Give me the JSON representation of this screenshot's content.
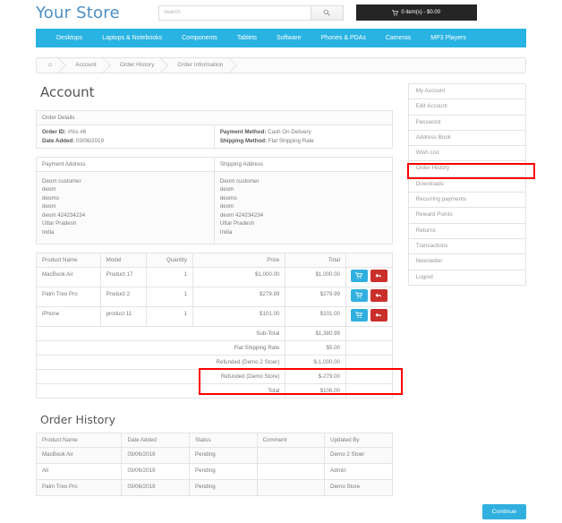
{
  "header": {
    "logo": "Your Store",
    "search_placeholder": "Search",
    "search_value": "",
    "search_icon": "search-icon",
    "cart_icon": "cart-icon",
    "cart_label": "0 item(s) - $0.00"
  },
  "nav": {
    "items": [
      {
        "label": "Desktops"
      },
      {
        "label": "Laptops & Notebooks"
      },
      {
        "label": "Components"
      },
      {
        "label": "Tablets"
      },
      {
        "label": "Software"
      },
      {
        "label": "Phones & PDAs"
      },
      {
        "label": "Cameras"
      },
      {
        "label": "MP3 Players"
      }
    ]
  },
  "breadcrumb": {
    "home_icon": "home-icon",
    "home_glyph": "⌂",
    "items": [
      {
        "label": "Account"
      },
      {
        "label": "Order History"
      },
      {
        "label": "Order Information"
      }
    ]
  },
  "page": {
    "title": "Account",
    "history_title": "Order History"
  },
  "order_details": {
    "panel_title": "Order Details",
    "order_id_label": "Order ID:",
    "order_id_value": "#%s #6",
    "date_added_label": "Date Added:",
    "date_added_value": "03/06/2019",
    "payment_method_label": "Payment Method:",
    "payment_method_value": "Cash On Delivery",
    "shipping_method_label": "Shipping Method:",
    "shipping_method_value": "Flat Shipping Rate"
  },
  "addresses": {
    "payment_title": "Payment Address",
    "shipping_title": "Shipping Address",
    "payment_lines": [
      "Deom customer",
      "deom",
      "deomo",
      "deom",
      "deom 424234234",
      "Uttar Pradesh",
      "India"
    ],
    "shipping_lines": [
      "Deom customer",
      "deom",
      "deomo",
      "deom",
      "deom 424234234",
      "Uttar Pradesh",
      "India"
    ]
  },
  "products": {
    "columns": [
      "Product Name",
      "Model",
      "Quantity",
      "Price",
      "Total",
      ""
    ],
    "rows": [
      {
        "name": "MacBook Air",
        "model": "Product 17",
        "quantity": "1",
        "price": "$1,000.00",
        "total": "$1,000.00",
        "cart_icon": "cart-icon",
        "return_icon": "return-arrow-icon"
      },
      {
        "name": "Palm Treo Pro",
        "model": "Product 2",
        "quantity": "1",
        "price": "$279.99",
        "total": "$279.99",
        "cart_icon": "cart-icon",
        "return_icon": "return-arrow-icon"
      },
      {
        "name": "iPhone",
        "model": "product 11",
        "quantity": "1",
        "price": "$101.00",
        "total": "$101.00",
        "cart_icon": "cart-icon",
        "return_icon": "return-arrow-icon"
      }
    ],
    "totals": [
      {
        "label": "Sub-Total",
        "value": "$1,380.99",
        "highlight": false
      },
      {
        "label": "Flat Shipping Rate",
        "value": "$5.00",
        "highlight": false
      },
      {
        "label": "Refunded (Demo 2 Stoer)",
        "value": "$-1,000.00",
        "highlight": true
      },
      {
        "label": "Refunded (Demo Store)",
        "value": "$-279.00",
        "highlight": true
      },
      {
        "label": "Total",
        "value": "$106.00",
        "highlight": false
      }
    ]
  },
  "order_history": {
    "columns": [
      "Product Name",
      "Date Added",
      "Status",
      "Comment",
      "Updated By"
    ],
    "rows": [
      {
        "product": "MacBook Air",
        "date": "03/06/2019",
        "status": "Pending",
        "comment": "",
        "updated_by": "Demo 2 Stoer"
      },
      {
        "product": "All",
        "date": "03/06/2019",
        "status": "Pending",
        "comment": "",
        "updated_by": "Admin"
      },
      {
        "product": "Palm Treo Pro",
        "date": "03/06/2019",
        "status": "Pending",
        "comment": "",
        "updated_by": "Demo Store"
      }
    ]
  },
  "sidebar": {
    "items": [
      {
        "label": "My Account",
        "highlighted": false
      },
      {
        "label": "Edit Account",
        "highlighted": false
      },
      {
        "label": "Password",
        "highlighted": false
      },
      {
        "label": "Address Book",
        "highlighted": false
      },
      {
        "label": "Wish List",
        "highlighted": false
      },
      {
        "label": "Order History",
        "highlighted": true
      },
      {
        "label": "Downloads",
        "highlighted": false
      },
      {
        "label": "Recurring payments",
        "highlighted": false
      },
      {
        "label": "Reward Points",
        "highlighted": false
      },
      {
        "label": "Returns",
        "highlighted": false
      },
      {
        "label": "Transactions",
        "highlighted": false
      },
      {
        "label": "Newsletter",
        "highlighted": false
      },
      {
        "label": "Logout",
        "highlighted": false
      }
    ]
  },
  "footer": {
    "continue_label": "Continue"
  },
  "colors": {
    "brand_blue": "#28b3e2",
    "logo_blue": "#4c8fc4",
    "cart_dark": "#252525",
    "danger_red": "#c9302c",
    "highlight_red": "#ff0000"
  }
}
